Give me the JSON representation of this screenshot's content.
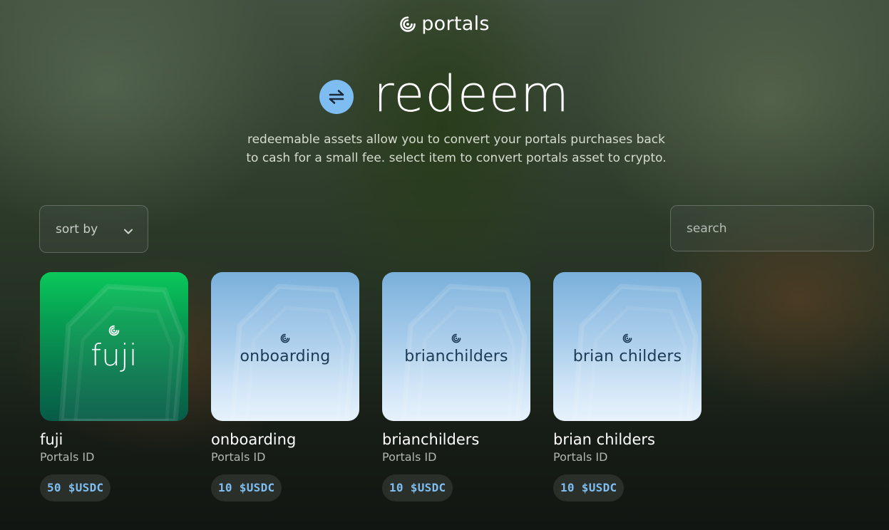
{
  "brand": {
    "name": "portals",
    "logo_icon": "spiral-icon"
  },
  "hero": {
    "title": "redeem",
    "icon": "swap-arrows-icon",
    "icon_color": "#7ebdf2"
  },
  "description": {
    "line1": "redeemable assets allow you to convert your portals purchases back",
    "line2": "to cash for a small fee. select item to convert portals asset to crypto."
  },
  "controls": {
    "sort_label": "sort by",
    "sort_icon": "chevron-down-icon",
    "search_placeholder": "search"
  },
  "colors": {
    "accent": "#7ebdf2",
    "green_card": "#07a153",
    "blue_card": "#a6cbea"
  },
  "cards": [
    {
      "overlay": "fuji",
      "title": "fuji",
      "subtitle": "Portals ID",
      "price": "50 $USDC",
      "theme": "green"
    },
    {
      "overlay": "onboarding",
      "title": "onboarding",
      "subtitle": "Portals ID",
      "price": "10 $USDC",
      "theme": "blue"
    },
    {
      "overlay": "brianchilders",
      "title": "brianchilders",
      "subtitle": "Portals ID",
      "price": "10 $USDC",
      "theme": "blue"
    },
    {
      "overlay": "brian childers",
      "title": "brian childers",
      "subtitle": "Portals ID",
      "price": "10 $USDC",
      "theme": "blue"
    }
  ]
}
